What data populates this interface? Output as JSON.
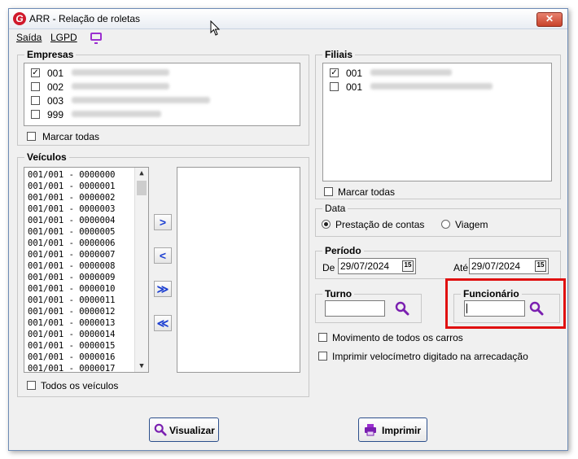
{
  "window": {
    "title": "ARR -  Relação de roletas",
    "logo_letter": "G",
    "close_label": "✕"
  },
  "menu": {
    "items": [
      "Saída",
      "LGPD"
    ]
  },
  "empresas": {
    "label": "Empresas",
    "items": [
      {
        "code": "001",
        "checked": true
      },
      {
        "code": "002",
        "checked": false
      },
      {
        "code": "003",
        "checked": false
      },
      {
        "code": "999",
        "checked": false
      }
    ],
    "mark_all_label": "Marcar todas"
  },
  "filiais": {
    "label": "Filiais",
    "items": [
      {
        "code": "001",
        "checked": true
      },
      {
        "code": "001",
        "checked": false
      }
    ],
    "mark_all_label": "Marcar todas"
  },
  "veiculos": {
    "label": "Veículos",
    "items": [
      "001/001 - 0000000",
      "001/001 - 0000001",
      "001/001 - 0000002",
      "001/001 - 0000003",
      "001/001 - 0000004",
      "001/001 - 0000005",
      "001/001 - 0000006",
      "001/001 - 0000007",
      "001/001 - 0000008",
      "001/001 - 0000009",
      "001/001 - 0000010",
      "001/001 - 0000011",
      "001/001 - 0000012",
      "001/001 - 0000013",
      "001/001 - 0000014",
      "001/001 - 0000015",
      "001/001 - 0000016",
      "001/001 - 0000017"
    ],
    "all_label": "Todos os veículos",
    "move_buttons": [
      ">",
      "<",
      "≫",
      "≪"
    ]
  },
  "data": {
    "label": "Data",
    "option_1": "Prestação de contas",
    "option_2": "Viagem",
    "selected": "Prestação de contas"
  },
  "periodo": {
    "label": "Período",
    "de_label": "De",
    "de_value": "29/07/2024",
    "ate_label": "Até",
    "ate_value": "29/07/2024",
    "cal_text": "15"
  },
  "turno": {
    "label": "Turno",
    "value": ""
  },
  "funcionario": {
    "label": "Funcionário",
    "value": ""
  },
  "options": {
    "movimento": "Movimento de todos os carros",
    "velocimetro": "Imprimir velocímetro digitado na arrecadação"
  },
  "buttons": {
    "visualizar": "Visualizar",
    "imprimir": "Imprimir"
  },
  "colors": {
    "accent_blue": "#1c3fd1",
    "search_purple": "#7a1fb0",
    "highlight_red": "#e01010",
    "logo_red": "#d0192b"
  }
}
